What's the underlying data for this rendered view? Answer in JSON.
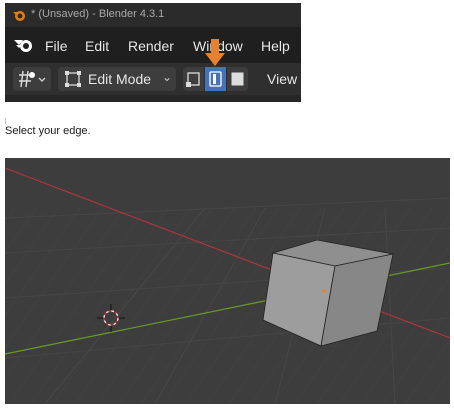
{
  "window": {
    "title": "* (Unsaved) - Blender 4.3.1"
  },
  "menu": {
    "items": [
      "File",
      "Edit",
      "Render",
      "Window",
      "Help"
    ]
  },
  "toolbar": {
    "mode_label": "Edit Mode",
    "view_label": "View",
    "active_select_mode": "edge"
  },
  "caption": "Select your edge.",
  "colors": {
    "accent_blue": "#4772b3",
    "arrow_orange": "#e8812e",
    "x_axis": "#b0353f",
    "y_axis": "#6b9a2a",
    "viewport_bg": "#3d3d3d"
  },
  "icons": [
    "blender-logo-icon",
    "pivot-icon",
    "edit-mode-icon",
    "vertex-select-icon",
    "edge-select-icon",
    "face-select-icon",
    "3d-cursor-icon"
  ]
}
